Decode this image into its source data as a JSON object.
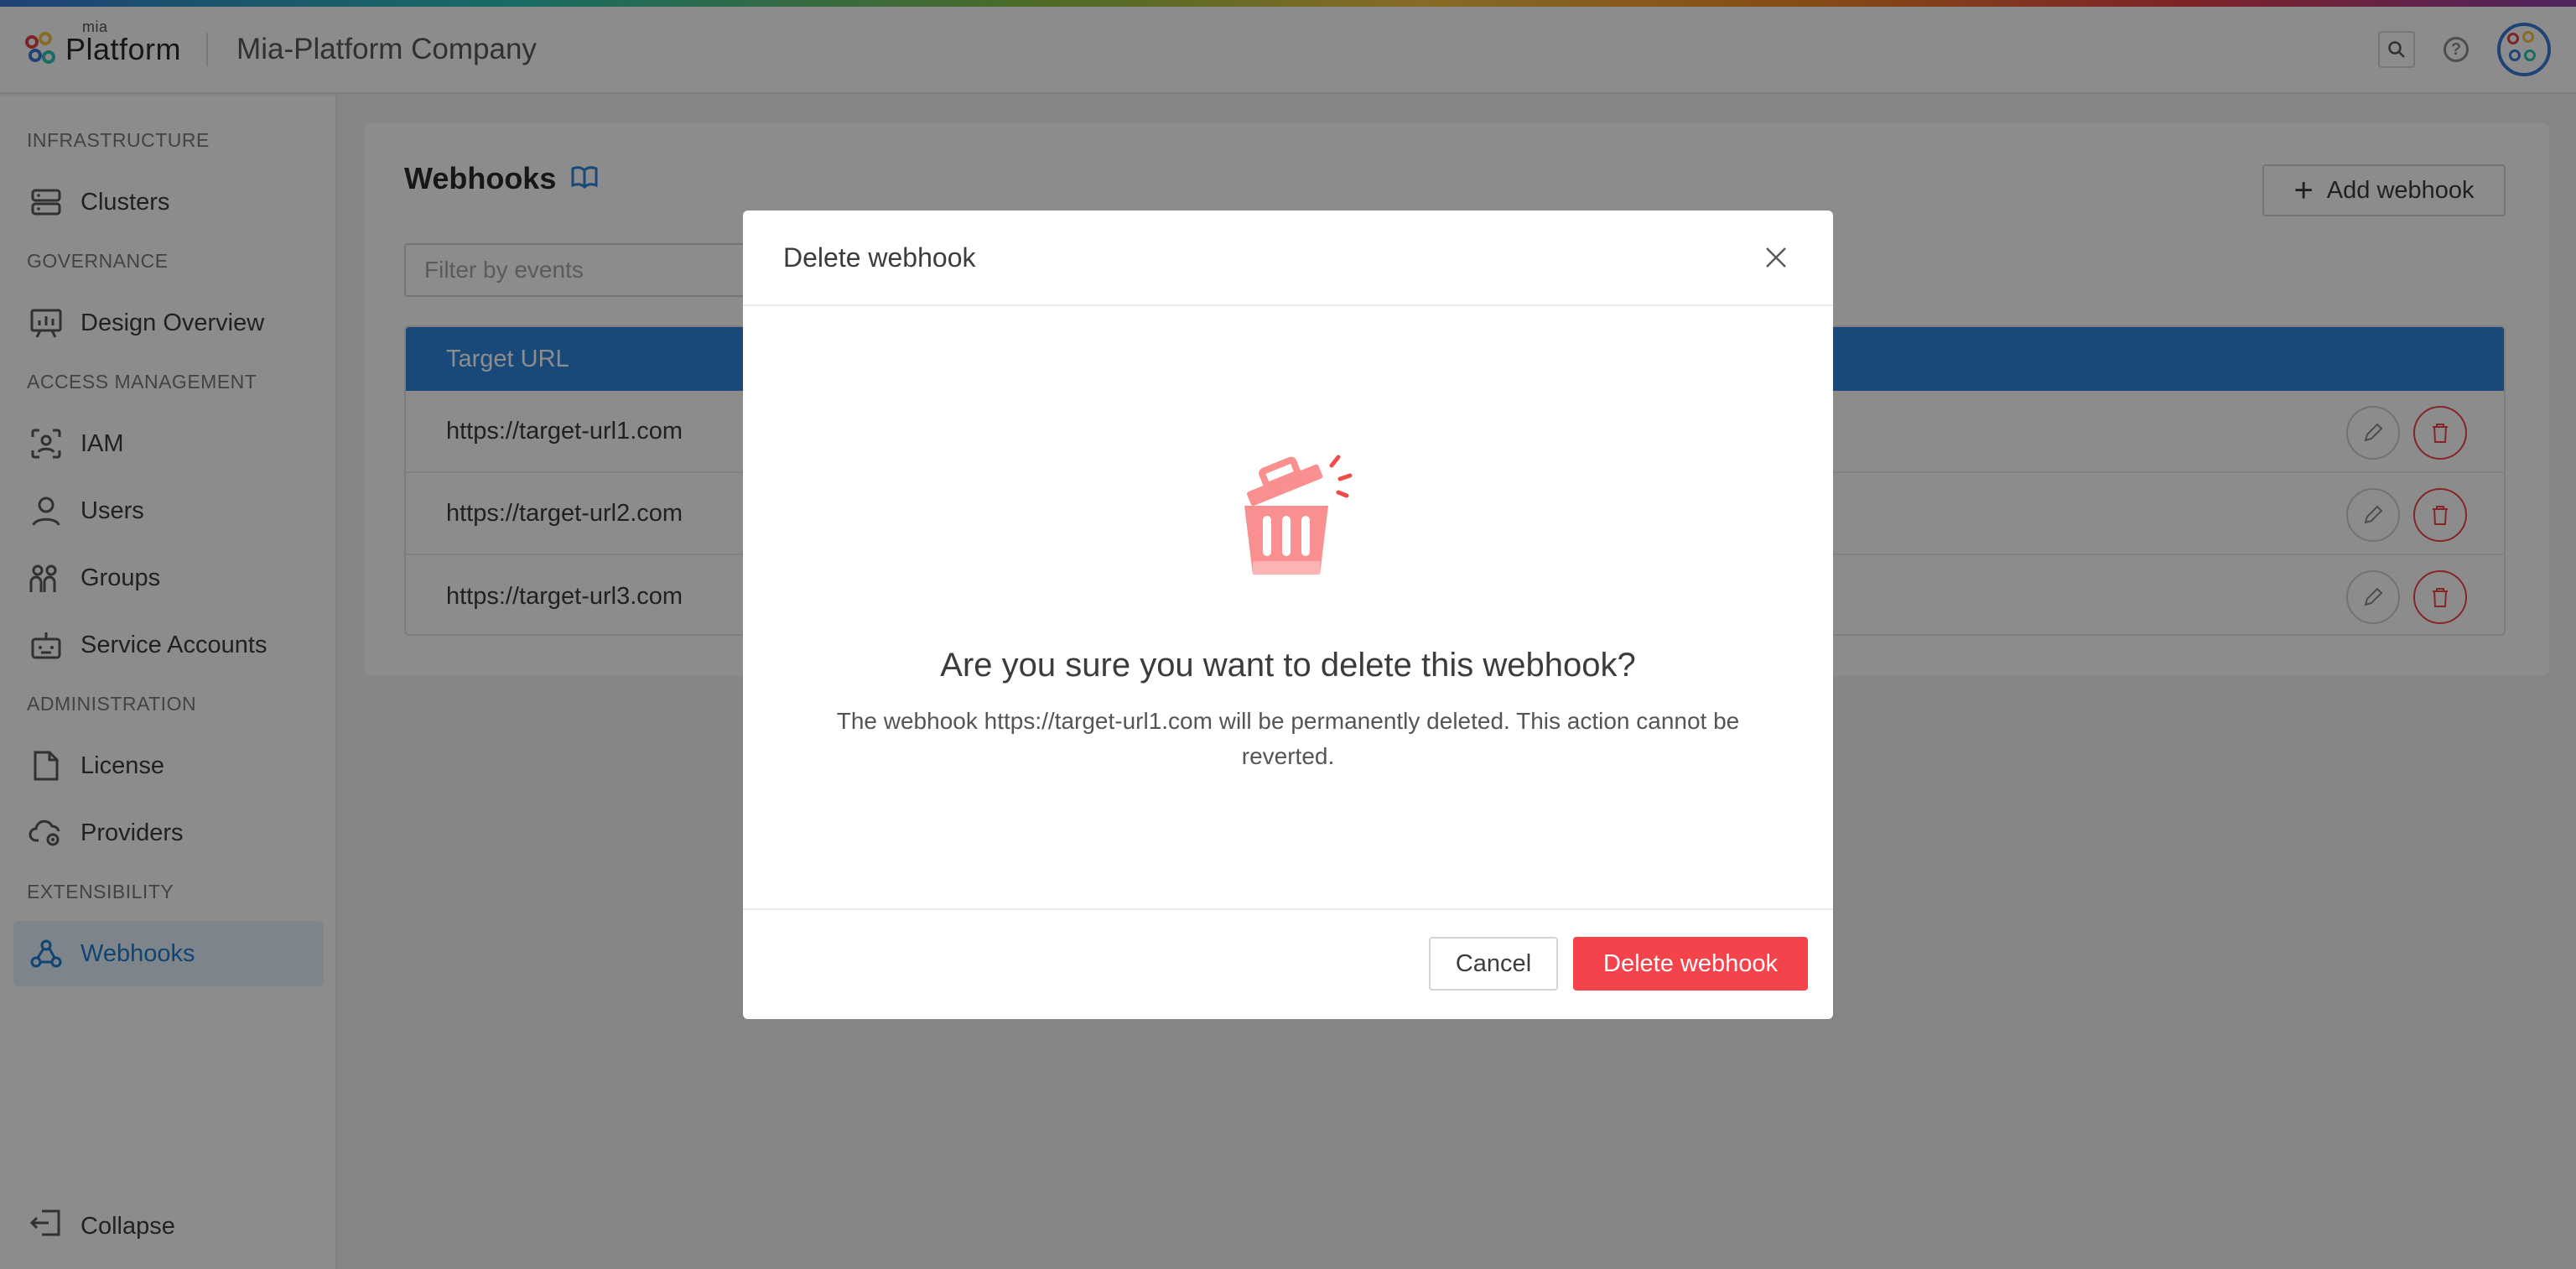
{
  "header": {
    "logo_small": "mia",
    "logo_text": "Platform",
    "company": "Mia-Platform Company"
  },
  "sidebar": {
    "sections": [
      {
        "title": "INFRASTRUCTURE",
        "items": [
          {
            "label": "Clusters",
            "icon": "server-icon"
          }
        ]
      },
      {
        "title": "GOVERNANCE",
        "items": [
          {
            "label": "Design Overview",
            "icon": "presentation-icon"
          }
        ]
      },
      {
        "title": "ACCESS MANAGEMENT",
        "items": [
          {
            "label": "IAM",
            "icon": "face-scan-icon"
          },
          {
            "label": "Users",
            "icon": "user-icon"
          },
          {
            "label": "Groups",
            "icon": "group-icon"
          },
          {
            "label": "Service Accounts",
            "icon": "robot-icon"
          }
        ]
      },
      {
        "title": "ADMINISTRATION",
        "items": [
          {
            "label": "License",
            "icon": "document-icon"
          },
          {
            "label": "Providers",
            "icon": "cloud-gear-icon"
          }
        ]
      },
      {
        "title": "EXTENSIBILITY",
        "items": [
          {
            "label": "Webhooks",
            "icon": "webhook-icon",
            "active": true
          }
        ]
      }
    ],
    "collapse_label": "Collapse"
  },
  "main": {
    "title": "Webhooks",
    "add_button": "Add webhook",
    "filter_placeholder": "Filter by events",
    "table": {
      "header": "Target URL",
      "rows": [
        "https://target-url1.com",
        "https://target-url2.com",
        "https://target-url3.com"
      ]
    }
  },
  "modal": {
    "title": "Delete webhook",
    "question": "Are you sure you want to delete this webhook?",
    "description": "The webhook https://target-url1.com will be permanently deleted. This action cannot be reverted.",
    "cancel": "Cancel",
    "confirm": "Delete webhook"
  },
  "colors": {
    "accent": "#2c86dc",
    "danger": "#f5434c",
    "active_bg": "#e6f2fc"
  }
}
